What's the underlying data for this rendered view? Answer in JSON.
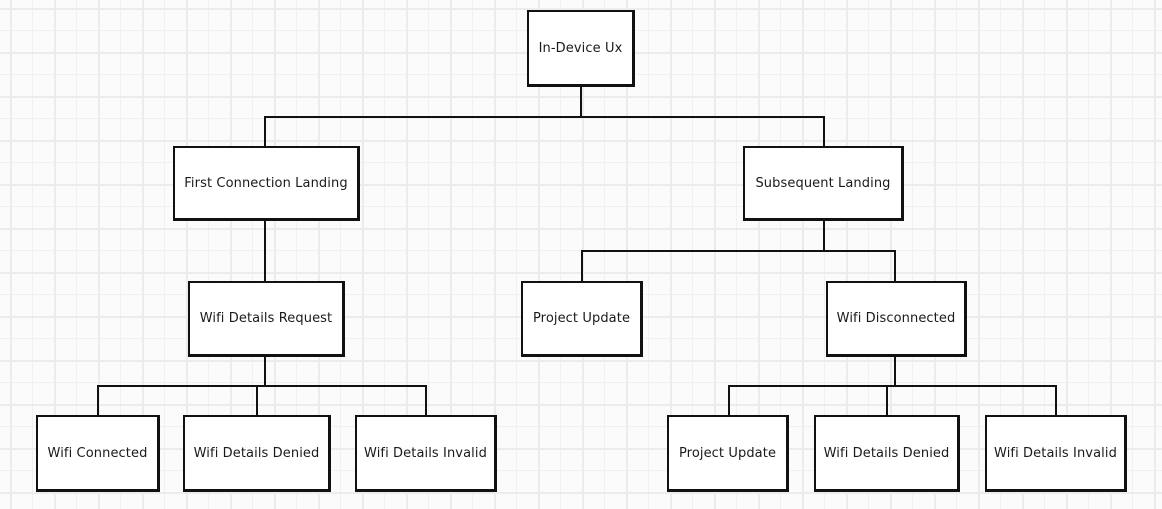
{
  "diagram": {
    "type": "hierarchy",
    "root": "In-Device Ux",
    "nodes": {
      "root": {
        "label": "In-Device Ux"
      },
      "first_connection": {
        "label": "First Connection Landing",
        "parent": "root"
      },
      "subsequent": {
        "label": "Subsequent Landing",
        "parent": "root"
      },
      "wifi_request": {
        "label": "Wifi Details Request",
        "parent": "first_connection"
      },
      "project_update_mid": {
        "label": "Project Update",
        "parent": "subsequent"
      },
      "wifi_disconnected": {
        "label": "Wifi Disconnected",
        "parent": "subsequent"
      },
      "wifi_connected": {
        "label": "Wifi Connected",
        "parent": "wifi_request"
      },
      "wifi_denied_left": {
        "label": "Wifi Details Denied",
        "parent": "wifi_request"
      },
      "wifi_invalid_left": {
        "label": "Wifi Details Invalid",
        "parent": "wifi_request"
      },
      "project_update_right": {
        "label": "Project Update",
        "parent": "wifi_disconnected"
      },
      "wifi_denied_right": {
        "label": "Wifi Details Denied",
        "parent": "wifi_disconnected"
      },
      "wifi_invalid_right": {
        "label": "Wifi Details Invalid",
        "parent": "wifi_disconnected"
      }
    },
    "colors": {
      "stroke": "#111111",
      "fill": "#ffffff",
      "grid": "#ececec"
    }
  }
}
